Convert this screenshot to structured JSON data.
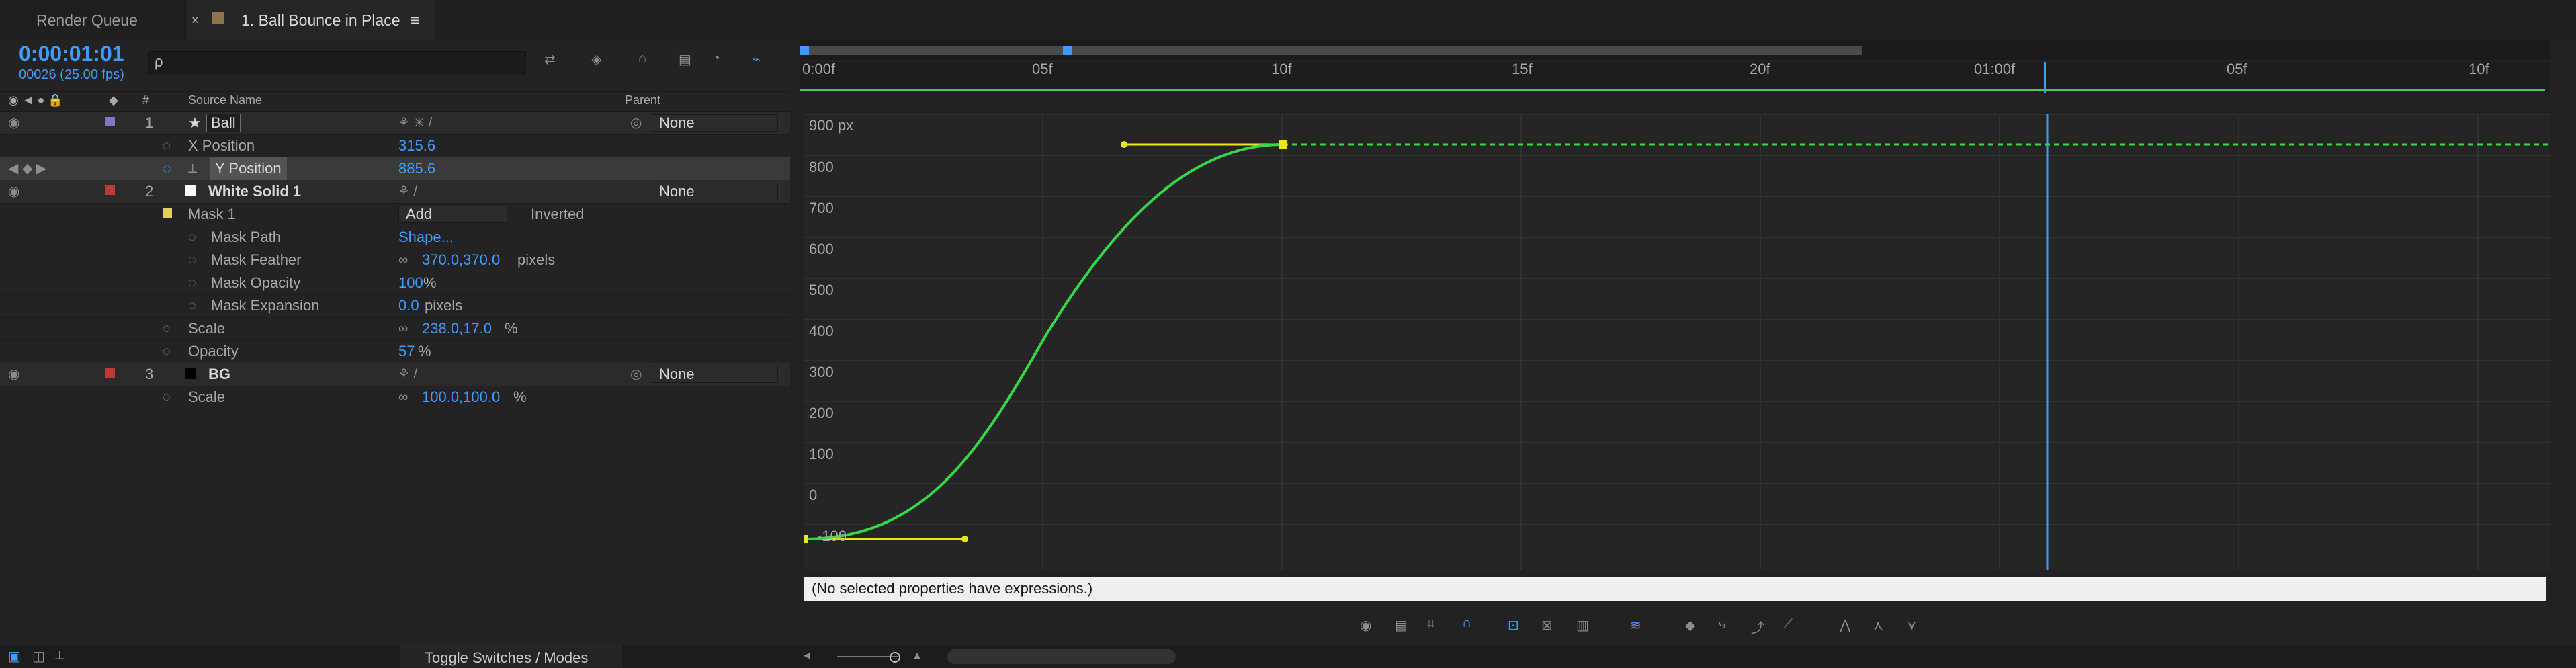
{
  "tabs": [
    {
      "label": "Render Queue"
    },
    {
      "label": "1. Ball Bounce in Place"
    }
  ],
  "timecode": "0:00:01:01",
  "fps": "00026 (25.00 fps)",
  "search": {
    "placeholder": "ρ"
  },
  "headers": {
    "source": "Source Name",
    "parent": "Parent"
  },
  "layers": [
    {
      "num": "1",
      "name": "Ball",
      "parent": "None"
    },
    {
      "num": "2",
      "name": "White Solid 1",
      "parent": "None"
    },
    {
      "num": "3",
      "name": "BG",
      "parent": "None"
    }
  ],
  "props": [
    {
      "label": "X Position",
      "value": "315.6"
    },
    {
      "label": "Y Position",
      "value": "885.6"
    },
    {
      "label": "Mask 1",
      "value": "Add",
      "extra": "Inverted"
    },
    {
      "label": "Mask Path",
      "value": "Shape..."
    },
    {
      "label": "Mask Feather",
      "value": "370.0,370.0",
      "unit": "pixels"
    },
    {
      "label": "Mask Opacity",
      "value": "100",
      "unit": "%"
    },
    {
      "label": "Mask Expansion",
      "value": "0.0",
      "unit": "pixels"
    },
    {
      "label": "Scale",
      "value": "238.0,17.0",
      "unit": "%"
    },
    {
      "label": "Opacity",
      "value": "57",
      "unit": "%"
    },
    {
      "label": "Scale",
      "value": "100.0,100.0",
      "unit": "%"
    }
  ],
  "ruler": [
    "0:00f",
    "05f",
    "10f",
    "15f",
    "20f",
    "01:00f",
    "05f",
    "10f"
  ],
  "graph": {
    "unit": "900 px",
    "labels": [
      "800",
      "700",
      "600",
      "500",
      "400",
      "300",
      "200",
      "100",
      "0",
      "-100"
    ]
  },
  "status": "(No selected properties have expressions.)",
  "bottom": {
    "toggle": "Toggle Switches / Modes"
  },
  "colors": {
    "accent": "#3f9bff",
    "curve": "#37d64b",
    "key": "#e8e61c"
  }
}
